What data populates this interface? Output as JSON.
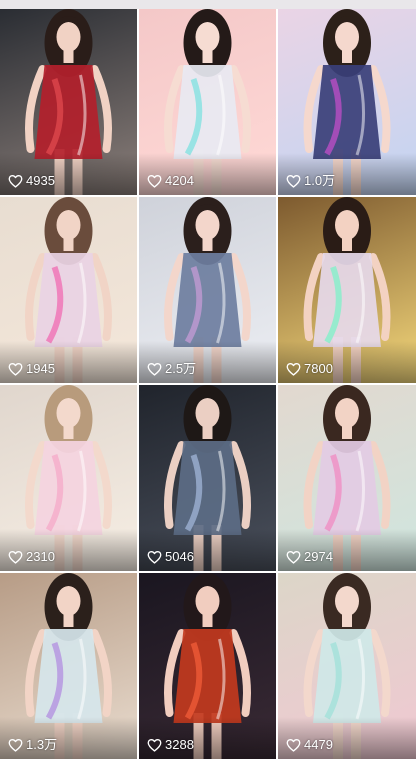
{
  "grid": {
    "columns": 3,
    "tiles": [
      {
        "likes": "4935",
        "bg": [
          "#2a2d33",
          "#8b7f7a"
        ],
        "dress": "#b3202b",
        "accent": "#e24a4f",
        "hair": "#2a1d19",
        "skin": "#f1d2c4"
      },
      {
        "likes": "4204",
        "bg": [
          "#f4c8c8",
          "#ffd9d6"
        ],
        "dress": "#e8e9f2",
        "accent": "#7ee2e0",
        "hair": "#241a18",
        "skin": "#f6dcd2"
      },
      {
        "likes": "1.0万",
        "bg": [
          "#ead4e5",
          "#c2d4f2"
        ],
        "dress": "#3a3f78",
        "accent": "#c24ec8",
        "hair": "#2c2019",
        "skin": "#f5d8cd"
      },
      {
        "likes": "1945",
        "bg": [
          "#e8ddd1",
          "#f4e7da"
        ],
        "dress": "#e9d2e4",
        "accent": "#f06bb2",
        "hair": "#6a4c3c",
        "skin": "#f1d4c6"
      },
      {
        "likes": "2.5万",
        "bg": [
          "#cfd2da",
          "#eceef3"
        ],
        "dress": "#6e7ea0",
        "accent": "#c59bd6",
        "hair": "#2b1f1c",
        "skin": "#f3d6cb"
      },
      {
        "likes": "7800",
        "bg": [
          "#7d5a2f",
          "#f5d97c"
        ],
        "dress": "#e6d9ea",
        "accent": "#7ef2c8",
        "hair": "#2a1c16",
        "skin": "#f3d2c2"
      },
      {
        "likes": "2310",
        "bg": [
          "#e0d6cd",
          "#f6eee4"
        ],
        "dress": "#f4d4e0",
        "accent": "#f6a8c8",
        "hair": "#b89b7c",
        "skin": "#f3d9cc"
      },
      {
        "likes": "5046",
        "bg": [
          "#20242c",
          "#4a505c"
        ],
        "dress": "#5c6d86",
        "accent": "#a2b5d8",
        "hair": "#1e1816",
        "skin": "#ebcfc3"
      },
      {
        "likes": "2974",
        "bg": [
          "#e2d8cf",
          "#cfe6df"
        ],
        "dress": "#e3cbe4",
        "accent": "#f08ac2",
        "hair": "#3a2820",
        "skin": "#f2d3c5"
      },
      {
        "likes": "1.3万",
        "bg": [
          "#b79c86",
          "#e9dccf"
        ],
        "dress": "#d6e6ec",
        "accent": "#b28de0",
        "hair": "#2b201b",
        "skin": "#f2d4c6"
      },
      {
        "likes": "3288",
        "bg": [
          "#1a1620",
          "#3a2a35"
        ],
        "dress": "#c23a1e",
        "accent": "#f25e3a",
        "hair": "#22181a",
        "skin": "#f1cdbf"
      },
      {
        "likes": "4479",
        "bg": [
          "#dcd6c8",
          "#f0c8d2"
        ],
        "dress": "#cfe8e8",
        "accent": "#9fe0d8",
        "hair": "#3a2a22",
        "skin": "#f3d8cc"
      }
    ]
  }
}
